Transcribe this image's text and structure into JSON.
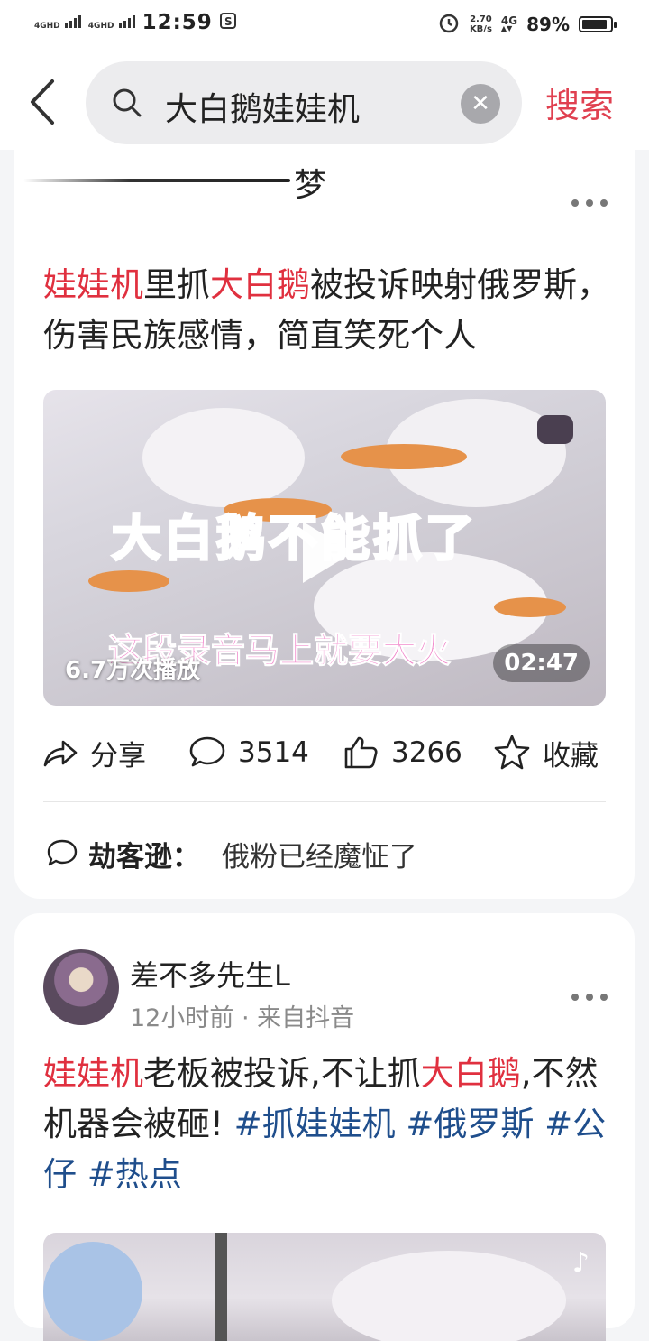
{
  "status_bar": {
    "net1": "4GHD",
    "net2": "4GHD",
    "time": "12:59",
    "speed_value": "2.70",
    "speed_unit": "KB/s",
    "net3": "4G",
    "battery": "89%"
  },
  "header": {
    "query": "大白鹅娃娃机",
    "search_label": "搜索"
  },
  "card1": {
    "prev_tail_text": "梦",
    "title_parts": [
      {
        "text": "娃娃机",
        "hl": true
      },
      {
        "text": "里抓",
        "hl": false
      },
      {
        "text": "大白鹅",
        "hl": true
      },
      {
        "text": "被投诉映射俄罗斯，伤害民族感情，简直笑死个人",
        "hl": false
      }
    ],
    "video": {
      "overlay_title": "大白鹅不能抓了",
      "overlay_sub": "这段录音马上就要大火",
      "views": "6.7万次播放",
      "duration": "02:47"
    },
    "actions": {
      "share": "分享",
      "comments": "3514",
      "likes": "3266",
      "favorite": "收藏"
    },
    "top_comment": {
      "author": "劫客逊：",
      "text": "俄粉已经魔怔了"
    }
  },
  "card2": {
    "author": "差不多先生L",
    "meta": "12小时前 · 来自抖音",
    "title_parts": [
      {
        "text": "娃娃机",
        "type": "hl"
      },
      {
        "text": "老板被投诉,不让抓",
        "type": "plain"
      },
      {
        "text": "大白鹅",
        "type": "hl"
      },
      {
        "text": ",不然机器会被砸! ",
        "type": "plain"
      },
      {
        "text": "#抓娃娃机",
        "type": "tag"
      },
      {
        "text": " ",
        "type": "plain"
      },
      {
        "text": "#俄罗斯",
        "type": "tag"
      },
      {
        "text": " ",
        "type": "plain"
      },
      {
        "text": "#公仔",
        "type": "tag"
      },
      {
        "text": " ",
        "type": "plain"
      },
      {
        "text": "#热点",
        "type": "tag"
      }
    ]
  },
  "colors": {
    "accent": "#e04050",
    "highlight": "#e0303f",
    "hashtag": "#1f4e8c"
  }
}
